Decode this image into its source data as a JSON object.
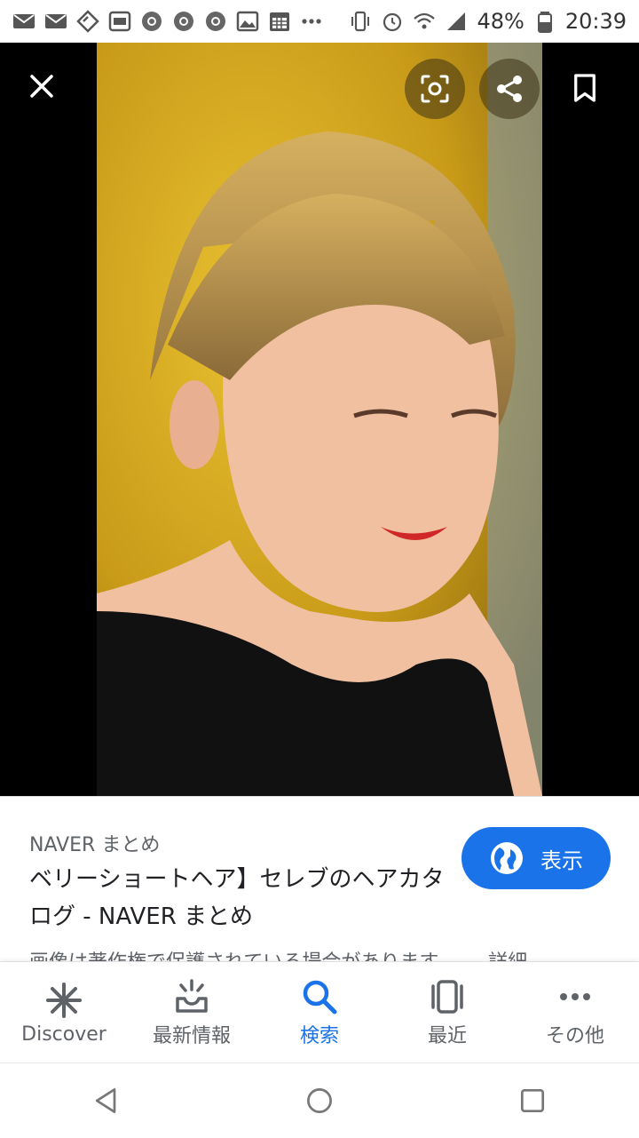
{
  "status_bar": {
    "battery": "48%",
    "time": "20:39",
    "left_icons": [
      "mail-au-icon",
      "mail-au-icon",
      "app-icon",
      "au-wallet-icon",
      "chrome-icon",
      "chrome-icon",
      "chrome-icon",
      "image-icon",
      "calendar-icon",
      "more-dots-icon"
    ],
    "right_icons": [
      "vibrate-icon",
      "alarm-icon",
      "wifi-icon",
      "signal-icon",
      "battery-icon"
    ]
  },
  "viewer": {
    "actions": [
      "close-icon",
      "lens-icon",
      "share-icon",
      "bookmark-icon"
    ]
  },
  "result": {
    "source": "NAVER まとめ",
    "title": "ベリーショートヘア】セレブのヘアカタログ - NAVER まとめ",
    "view_button": "表示",
    "copyright": "画像は著作権で保護されている場合があります。",
    "details": "詳細"
  },
  "bottom_nav": {
    "items": [
      {
        "label": "Discover",
        "icon": "asterisk-icon"
      },
      {
        "label": "最新情報",
        "icon": "updates-icon"
      },
      {
        "label": "検索",
        "icon": "search-icon"
      },
      {
        "label": "最近",
        "icon": "recent-icon"
      },
      {
        "label": "その他",
        "icon": "more-icon"
      }
    ],
    "active": "検索"
  },
  "colors": {
    "accent": "#1a73e8",
    "panel_background": "#ffffff",
    "viewer_background": "#000000"
  }
}
